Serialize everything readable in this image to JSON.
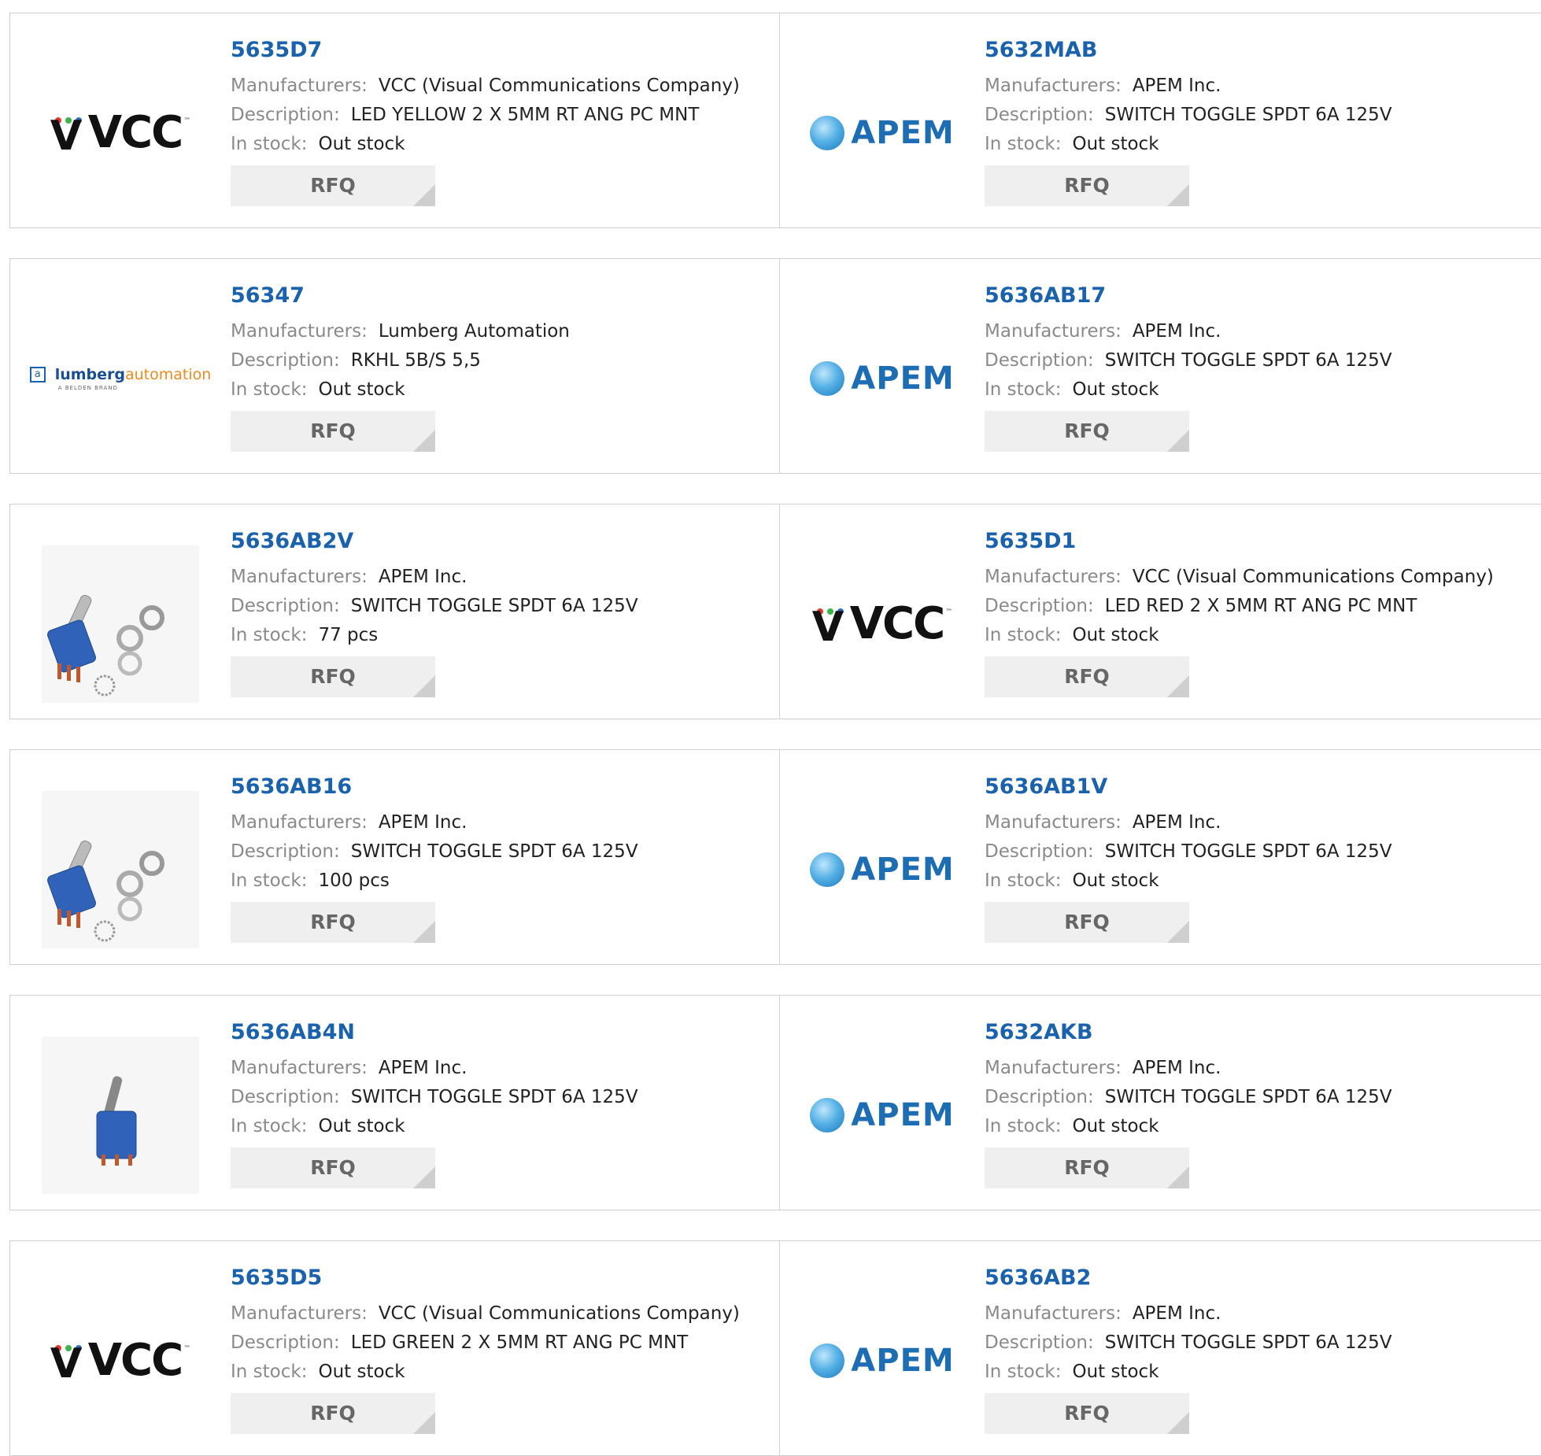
{
  "labels": {
    "manufacturers": "Manufacturers:",
    "description": "Description:",
    "in_stock": "In stock:",
    "rfq": "RFQ"
  },
  "logos": {
    "vcc": "VCC",
    "vcc_tm": "™",
    "apem": "APEM",
    "lumberg_main": "lumberg",
    "lumberg_accent": "automation",
    "lumberg_sub": "A BELDEN BRAND"
  },
  "colors": {
    "part_link": "#1a62ad",
    "label": "#8a8a8a",
    "rfq_bg": "#efefef"
  },
  "products": [
    {
      "part": "5635D7",
      "logo": "vcc",
      "manufacturer": "VCC (Visual Communications Company)",
      "description": "LED YELLOW 2 X 5MM RT ANG PC MNT",
      "stock": "Out stock"
    },
    {
      "part": "5632MAB",
      "logo": "apem",
      "manufacturer": "APEM Inc.",
      "description": "SWITCH TOGGLE SPDT 6A 125V",
      "stock": "Out stock"
    },
    {
      "part": "56347",
      "logo": "lumberg",
      "manufacturer": "Lumberg Automation",
      "description": "RKHL 5B/S 5,5",
      "stock": "Out stock"
    },
    {
      "part": "5636AB17",
      "logo": "apem",
      "manufacturer": "APEM Inc.",
      "description": "SWITCH TOGGLE SPDT 6A 125V",
      "stock": "Out stock"
    },
    {
      "part": "5636AB2V",
      "logo": "photo-toggle-hardware",
      "manufacturer": "APEM Inc.",
      "description": "SWITCH TOGGLE SPDT 6A 125V",
      "stock": "77 pcs"
    },
    {
      "part": "5635D1",
      "logo": "vcc",
      "manufacturer": "VCC (Visual Communications Company)",
      "description": "LED RED 2 X 5MM RT ANG PC MNT",
      "stock": "Out stock"
    },
    {
      "part": "5636AB16",
      "logo": "photo-toggle-hardware",
      "manufacturer": "APEM Inc.",
      "description": "SWITCH TOGGLE SPDT 6A 125V",
      "stock": "100 pcs"
    },
    {
      "part": "5636AB1V",
      "logo": "apem",
      "manufacturer": "APEM Inc.",
      "description": "SWITCH TOGGLE SPDT 6A 125V",
      "stock": "Out stock"
    },
    {
      "part": "5636AB4N",
      "logo": "photo-toggle",
      "manufacturer": "APEM Inc.",
      "description": "SWITCH TOGGLE SPDT 6A 125V",
      "stock": "Out stock"
    },
    {
      "part": "5632AKB",
      "logo": "apem",
      "manufacturer": "APEM Inc.",
      "description": "SWITCH TOGGLE SPDT 6A 125V",
      "stock": "Out stock"
    },
    {
      "part": "5635D5",
      "logo": "vcc",
      "manufacturer": "VCC (Visual Communications Company)",
      "description": "LED GREEN 2 X 5MM RT ANG PC MNT",
      "stock": "Out stock"
    },
    {
      "part": "5636AB2",
      "logo": "apem",
      "manufacturer": "APEM Inc.",
      "description": "SWITCH TOGGLE SPDT 6A 125V",
      "stock": "Out stock"
    }
  ]
}
